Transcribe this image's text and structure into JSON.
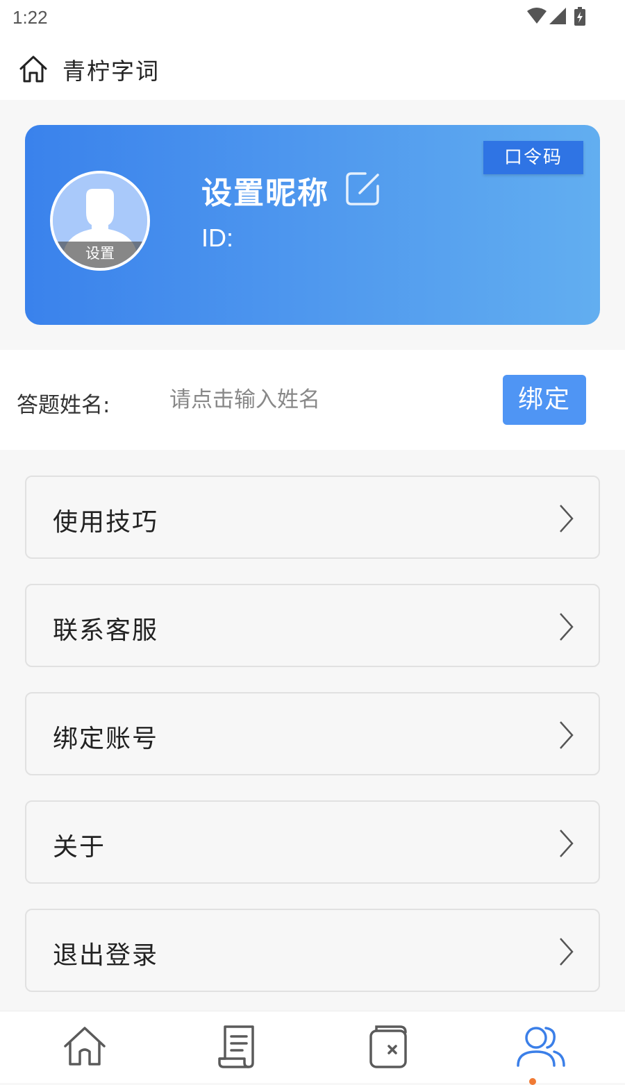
{
  "status_bar": {
    "time": "1:22",
    "icons": [
      "wifi-icon",
      "signal-icon",
      "battery-charging-icon"
    ]
  },
  "header": {
    "title": "青柠字词",
    "icon": "home-icon"
  },
  "profile": {
    "nickname": "设置昵称",
    "id_label": "ID:",
    "avatar_label": "设置",
    "passcode_button": "口令码",
    "colors": {
      "gradient_start": "#3a82ec",
      "gradient_end": "#62aef0",
      "passcode_bg": "#2f74e4"
    }
  },
  "answer_name": {
    "label": "答题姓名:",
    "placeholder": "请点击输入姓名",
    "value": "",
    "bind_button": "绑定",
    "bind_color": "#4f95f4"
  },
  "menu": {
    "items": [
      {
        "label": "使用技巧"
      },
      {
        "label": "联系客服"
      },
      {
        "label": "绑定账号"
      },
      {
        "label": "关于"
      },
      {
        "label": "退出登录"
      }
    ]
  },
  "bottom_nav": {
    "tabs": [
      {
        "icon": "home-icon",
        "active": false
      },
      {
        "icon": "document-icon",
        "active": false
      },
      {
        "icon": "wrong-book-icon",
        "active": false
      },
      {
        "icon": "users-icon",
        "active": true
      }
    ],
    "active_color": "#3b7fe8",
    "inactive_color": "#5a5a5a"
  }
}
